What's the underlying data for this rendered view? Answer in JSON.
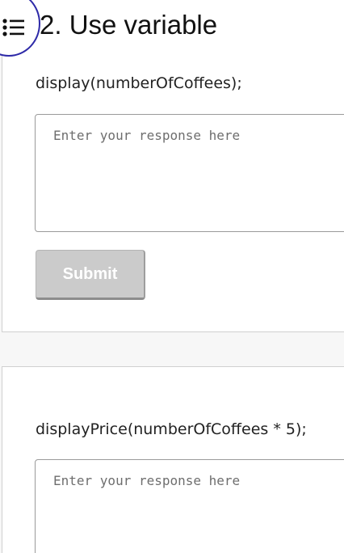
{
  "sections": [
    {
      "title": "2. Use variable",
      "prompt": "display(numberOfCoffees);",
      "response": {
        "value": "",
        "placeholder": "Enter your response here"
      },
      "submit_label": "Submit"
    },
    {
      "prompt": "displayPrice(numberOfCoffees * 5);",
      "response": {
        "value": "",
        "placeholder": "Enter your response here"
      }
    }
  ],
  "icons": {
    "toc": "list-icon"
  },
  "colors": {
    "toc_border": "#2e2aa8",
    "submit_disabled_bg": "#cbcbcb",
    "card_border": "#d0d0d0",
    "page_bg": "#f7f7f7"
  }
}
